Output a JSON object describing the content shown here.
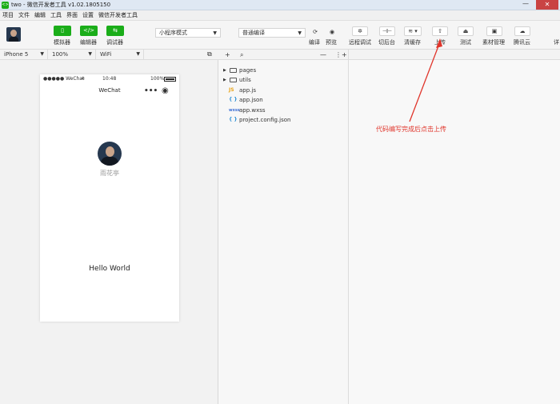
{
  "window": {
    "app_icon": "<>",
    "title": "two - 微信开发者工具 v1.02.1805150",
    "minimize": "—",
    "close": "✕"
  },
  "menu": {
    "items": [
      "项目",
      "文件",
      "编辑",
      "工具",
      "界面",
      "设置",
      "微信开发者工具"
    ]
  },
  "toolbar": {
    "simulator": {
      "icon": "▯",
      "label": "模拟器"
    },
    "editor": {
      "icon": "</>",
      "label": "编辑器"
    },
    "debugger": {
      "icon": "⇆",
      "label": "调试器"
    },
    "mode_select": "小程序模式",
    "compile_select": "普通编译",
    "compile": {
      "icon": "⟳",
      "label": "编译"
    },
    "preview": {
      "icon": "◉",
      "label": "预览"
    },
    "remote_debug": {
      "icon": "✲",
      "label": "远程调试"
    },
    "background": {
      "icon": "⊣⊢",
      "label": "切后台"
    },
    "clear_cache": {
      "icon": "≋ ▾",
      "label": "清缓存"
    },
    "upload": {
      "icon": "⇧",
      "label": "上传"
    },
    "test": {
      "icon": "⏏",
      "label": "测试"
    },
    "assets": {
      "icon": "▣",
      "label": "素材管理"
    },
    "tencent_cloud": {
      "icon": "☁",
      "label": "腾讯云"
    },
    "details_partial": "详"
  },
  "devicebar": {
    "device": "iPhone 5",
    "zoom": "100%",
    "network": "WiFi",
    "detach_icon": "⧉"
  },
  "simulator": {
    "status_left": "●●●●● WeChat",
    "wifi_icon": "≈",
    "time": "10:48",
    "battery": "100%",
    "nav_title": "WeChat",
    "capsule_dots": "•••",
    "capsule_record": "◉",
    "nickname": "雨花亭",
    "hello": "Hello World"
  },
  "filetree": {
    "add": "+",
    "search": "⌕",
    "collapse": "—",
    "more": "⋮+",
    "items": [
      {
        "type": "folder",
        "name": "pages"
      },
      {
        "type": "folder",
        "name": "utils"
      },
      {
        "type": "js",
        "badge": "JS",
        "name": "app.js"
      },
      {
        "type": "json",
        "badge": "{ }",
        "name": "app.json"
      },
      {
        "type": "wxss",
        "badge": "wxss",
        "name": "app.wxss"
      },
      {
        "type": "json",
        "badge": "{ }",
        "name": "project.config.json"
      }
    ]
  },
  "annotation": {
    "text": "代码编写完成后点击上传",
    "color": "#e0352b"
  },
  "colors": {
    "accent_green": "#1aad19",
    "annotation_red": "#e0352b"
  }
}
